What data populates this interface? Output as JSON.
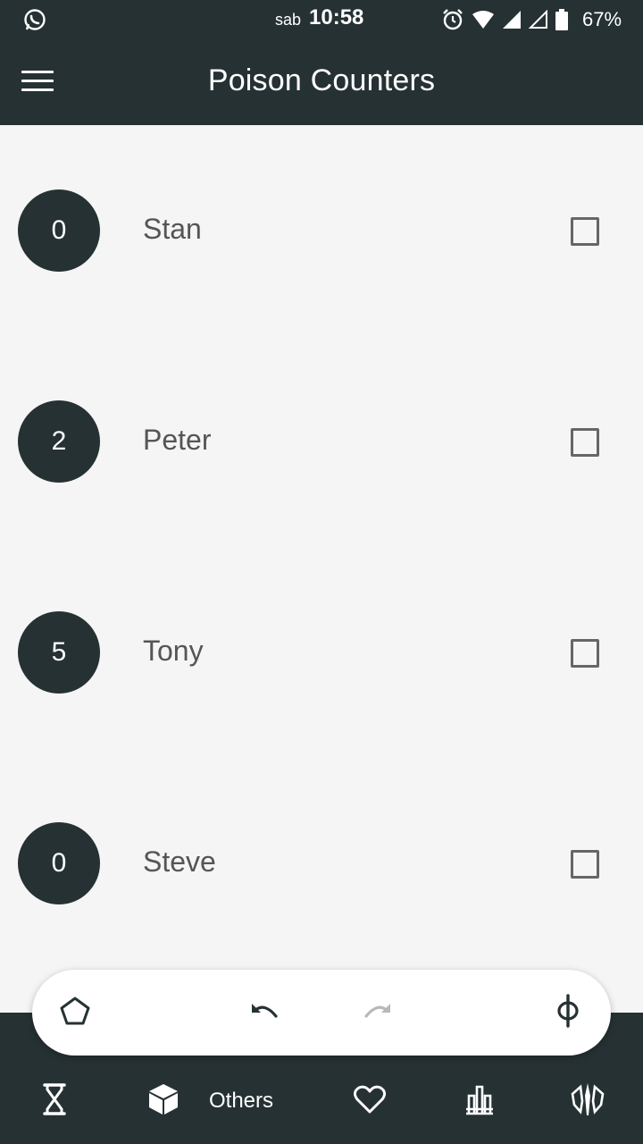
{
  "status_bar": {
    "day": "sab",
    "time": "10:58",
    "battery": "67%"
  },
  "app_bar": {
    "title": "Poison Counters"
  },
  "players": [
    {
      "count": "0",
      "name": "Stan"
    },
    {
      "count": "2",
      "name": "Peter"
    },
    {
      "count": "5",
      "name": "Tony"
    },
    {
      "count": "0",
      "name": "Steve"
    }
  ],
  "bottom_nav": {
    "active_label": "Others"
  },
  "colors": {
    "primary": "#263133",
    "background": "#f5f5f5",
    "text": "#555555"
  }
}
